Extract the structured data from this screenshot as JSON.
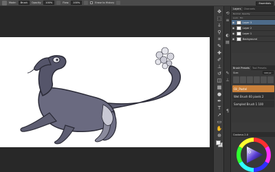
{
  "options_bar": {
    "mode_label": "Mode:",
    "mode_value": "Brush",
    "opacity_label": "Opacity:",
    "opacity_value": "100%",
    "flow_label": "Flow:",
    "flow_value": "100%",
    "sample_all_label": "Sample All Layers",
    "history_label": "Erase to History",
    "workspace": "Essentials"
  },
  "panels": {
    "layers_tab": "Layers",
    "channels_tab": "Channels",
    "blend_mode": "Normal",
    "opacity_label": "Opacity:",
    "lock_label": "Lock:",
    "fill_label": "Fill:",
    "layers": [
      {
        "name": "Layer 3",
        "selected": true
      },
      {
        "name": "Layer 2",
        "selected": false
      },
      {
        "name": "Layer 1",
        "selected": false
      },
      {
        "name": "Background",
        "selected": false
      }
    ],
    "brush_presets_tab": "Brush Presets",
    "tool_presets_tab": "Tool Presets",
    "size_label": "Size:",
    "size_value": "100 px",
    "brush_items": [
      {
        "label": "Oil_Pastel",
        "selected": true
      },
      {
        "label": "Wet Brush 60 pixels 2",
        "selected": false
      },
      {
        "label": "Sampled Brush 1 100",
        "selected": false
      }
    ],
    "color_panel_title": "Coolorus 2.0"
  },
  "icons": {
    "eye": "eye-icon",
    "brush_tool": "brush-icon"
  }
}
